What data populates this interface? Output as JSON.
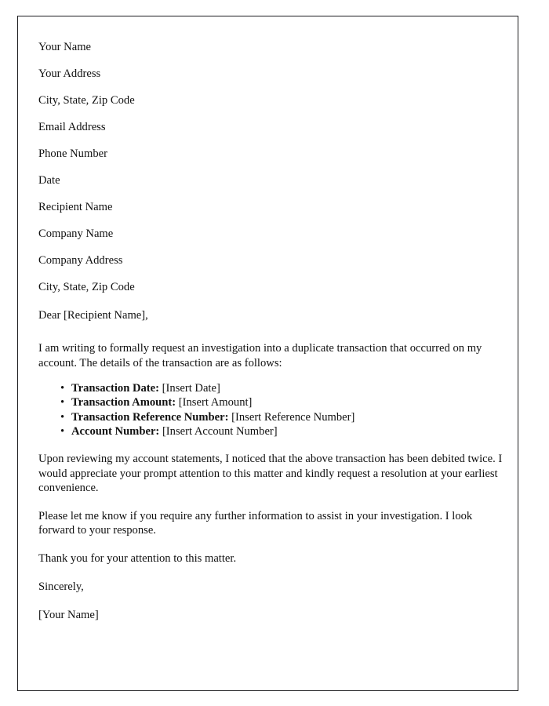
{
  "document": {
    "sender_block": [
      "Your Name",
      "Your Address",
      "City, State, Zip Code",
      "Email Address",
      "Phone Number",
      "Date"
    ],
    "recipient_block": [
      "Recipient Name",
      "Company Name",
      "Company Address",
      "City, State, Zip Code"
    ],
    "salutation": "Dear [Recipient Name],",
    "intro_paragraph": "I am writing to formally request an investigation into a duplicate transaction that occurred on my account. The details of the transaction are as follows:",
    "bullet_glyph": "•",
    "details": [
      {
        "label": "Transaction Date:",
        "value": "[Insert Date]"
      },
      {
        "label": "Transaction Amount:",
        "value": "[Insert Amount]"
      },
      {
        "label": "Transaction Reference Number:",
        "value": "[Insert Reference Number]"
      },
      {
        "label": "Account Number:",
        "value": "[Insert Account Number]"
      }
    ],
    "body_paragraphs": [
      "Upon reviewing my account statements, I noticed that the above transaction has been debited twice. I would appreciate your prompt attention to this matter and kindly request a resolution at your earliest convenience.",
      "Please let me know if you require any further information to assist in your investigation. I look forward to your response.",
      "Thank you for your attention to this matter."
    ],
    "closing": "Sincerely,",
    "signature": "[Your Name]",
    "colors": {
      "text": "#111111",
      "page_border": "#1d1d1f",
      "page_background": "#ffffff"
    }
  }
}
